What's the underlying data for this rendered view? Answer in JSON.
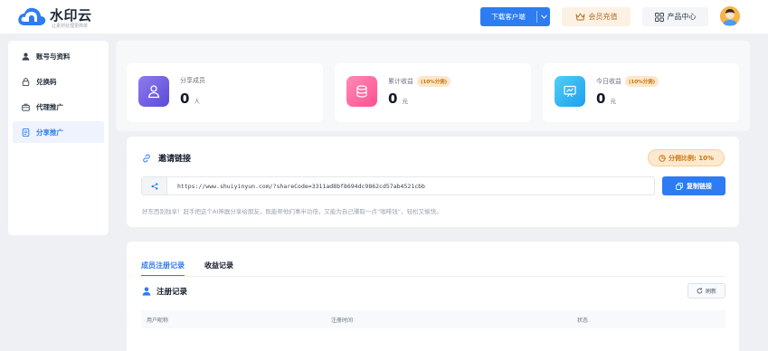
{
  "header": {
    "brand_name": "水印云",
    "brand_slogan": "让素材处理更简单",
    "download_label": "下载客户端",
    "vip_label": "会员充值",
    "product_label": "产品中心"
  },
  "sidebar": {
    "items": [
      {
        "label": "账号与资料",
        "icon": "user-icon",
        "active": false
      },
      {
        "label": "兑换码",
        "icon": "lock-icon",
        "active": false
      },
      {
        "label": "代理推广",
        "icon": "briefcase-icon",
        "active": false
      },
      {
        "label": "分享推广",
        "icon": "document-icon",
        "active": true
      }
    ]
  },
  "stats": [
    {
      "label": "分享成员",
      "value": "0",
      "unit": "人",
      "badge": "",
      "icon": "person-icon",
      "color": "#6f5fe0"
    },
    {
      "label": "累计收益",
      "value": "0",
      "unit": "元",
      "badge": "(10%分佣)",
      "icon": "coins-icon",
      "color": "#ff5f99"
    },
    {
      "label": "今日收益",
      "value": "0",
      "unit": "元",
      "badge": "(10%分佣)",
      "icon": "chart-board-icon",
      "color": "#2bb6f2"
    }
  ],
  "invite": {
    "title": "邀请链接",
    "ratio": "分佣比例: 10%",
    "link": "https://www.shuiyinyun.com/?shareCode=3311ad8bf8694dc9862cd57ab4521cbb",
    "copy_label": "复制链接",
    "hint": "好东西别独享！赶手把这个AI神器分享给朋友，既能帮他们事半功倍，又能为自己赚取一点“咖啡钱”，轻松又愉快。"
  },
  "records": {
    "tabs": [
      {
        "label": "成员注册记录",
        "active": true
      },
      {
        "label": "收益记录",
        "active": false
      }
    ],
    "title": "注册记录",
    "refresh_label": "刷新",
    "columns": [
      "用户昵称",
      "注册时间",
      "状态"
    ]
  },
  "colors": {
    "primary": "#2d7cf2",
    "vip_bg": "#fdf1e3",
    "vip_text": "#b0702a",
    "badge_bg": "#fde7c9",
    "badge_text": "#c47611"
  }
}
